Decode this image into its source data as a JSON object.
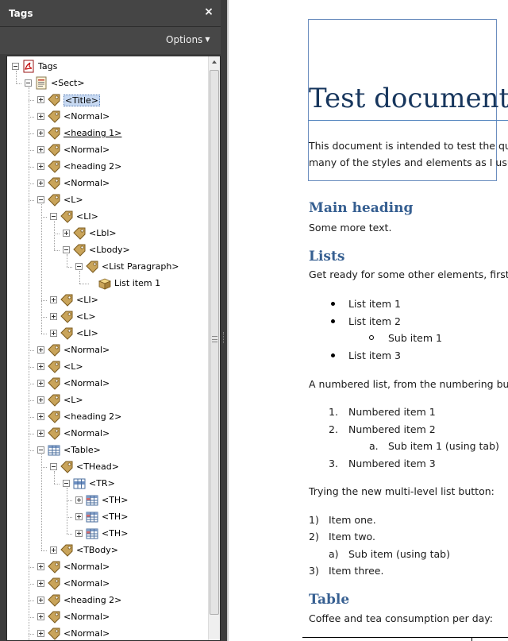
{
  "panel": {
    "title": "Tags",
    "close_glyph": "×",
    "options_label": "Options"
  },
  "tree": [
    {
      "depth": 0,
      "label": "Tags",
      "expanded": true,
      "icon": "pdf-icon"
    },
    {
      "depth": 1,
      "label": "<Sect>",
      "expanded": true,
      "icon": "page-icon"
    },
    {
      "depth": 2,
      "label": "<Title>",
      "expanded": false,
      "icon": "tag-icon",
      "selected": true
    },
    {
      "depth": 2,
      "label": "<Normal>",
      "expanded": false,
      "icon": "tag-icon"
    },
    {
      "depth": 2,
      "label": "<heading 1>",
      "expanded": false,
      "icon": "tag-icon",
      "underline": true
    },
    {
      "depth": 2,
      "label": "<Normal>",
      "expanded": false,
      "icon": "tag-icon"
    },
    {
      "depth": 2,
      "label": "<heading 2>",
      "expanded": false,
      "icon": "tag-icon"
    },
    {
      "depth": 2,
      "label": "<Normal>",
      "expanded": false,
      "icon": "tag-icon"
    },
    {
      "depth": 2,
      "label": "<L>",
      "expanded": true,
      "icon": "tag-icon"
    },
    {
      "depth": 3,
      "label": "<LI>",
      "expanded": true,
      "icon": "tag-icon"
    },
    {
      "depth": 4,
      "label": "<Lbl>",
      "expanded": false,
      "icon": "tag-icon"
    },
    {
      "depth": 4,
      "label": "<Lbody>",
      "expanded": true,
      "icon": "tag-icon"
    },
    {
      "depth": 5,
      "label": "<List Paragraph>",
      "expanded": true,
      "icon": "tag-icon"
    },
    {
      "depth": 6,
      "label": "List item 1",
      "expanded": null,
      "icon": "content-box-icon"
    },
    {
      "depth": 3,
      "label": "<LI>",
      "expanded": false,
      "icon": "tag-icon"
    },
    {
      "depth": 3,
      "label": "<L>",
      "expanded": false,
      "icon": "tag-icon"
    },
    {
      "depth": 3,
      "label": "<LI>",
      "expanded": false,
      "icon": "tag-icon"
    },
    {
      "depth": 2,
      "label": "<Normal>",
      "expanded": false,
      "icon": "tag-icon"
    },
    {
      "depth": 2,
      "label": "<L>",
      "expanded": false,
      "icon": "tag-icon"
    },
    {
      "depth": 2,
      "label": "<Normal>",
      "expanded": false,
      "icon": "tag-icon"
    },
    {
      "depth": 2,
      "label": "<L>",
      "expanded": false,
      "icon": "tag-icon"
    },
    {
      "depth": 2,
      "label": "<heading 2>",
      "expanded": false,
      "icon": "tag-icon"
    },
    {
      "depth": 2,
      "label": "<Normal>",
      "expanded": false,
      "icon": "tag-icon"
    },
    {
      "depth": 2,
      "label": "<Table>",
      "expanded": true,
      "icon": "table-icon"
    },
    {
      "depth": 3,
      "label": "<THead>",
      "expanded": true,
      "icon": "tag-icon"
    },
    {
      "depth": 4,
      "label": "<TR>",
      "expanded": true,
      "icon": "table-row-icon"
    },
    {
      "depth": 5,
      "label": "<TH>",
      "expanded": false,
      "icon": "table-cell-icon"
    },
    {
      "depth": 5,
      "label": "<TH>",
      "expanded": false,
      "icon": "table-cell-icon"
    },
    {
      "depth": 5,
      "label": "<TH>",
      "expanded": false,
      "icon": "table-cell-icon"
    },
    {
      "depth": 3,
      "label": "<TBody>",
      "expanded": false,
      "icon": "tag-icon"
    },
    {
      "depth": 2,
      "label": "<Normal>",
      "expanded": false,
      "icon": "tag-icon"
    },
    {
      "depth": 2,
      "label": "<Normal>",
      "expanded": false,
      "icon": "tag-icon"
    },
    {
      "depth": 2,
      "label": "<heading 2>",
      "expanded": false,
      "icon": "tag-icon"
    },
    {
      "depth": 2,
      "label": "<Normal>",
      "expanded": false,
      "icon": "tag-icon"
    },
    {
      "depth": 2,
      "label": "<Normal>",
      "expanded": false,
      "icon": "tag-icon"
    }
  ],
  "document": {
    "title": "Test document",
    "intro_line1": "This document is intended to test the qu",
    "intro_line2": "many of the styles and elements as I usu",
    "heading_main": "Main heading",
    "main_text": "Some more text.",
    "heading_lists": "Lists",
    "lists_text": "Get ready for some other elements, first",
    "bullets": [
      "List item 1",
      "List item 2",
      "Sub item 1",
      "List item 3"
    ],
    "numbered_intro": "A numbered list, from the numbering bu",
    "numbered": [
      {
        "marker": "1.",
        "text": "Numbered item 1"
      },
      {
        "marker": "2.",
        "text": "Numbered item 2"
      },
      {
        "marker": "a.",
        "text": "Sub item 1 (using tab)"
      },
      {
        "marker": "3.",
        "text": "Numbered item 3"
      }
    ],
    "multilevel_intro": "Trying the new multi-level list button:",
    "multilevel": [
      {
        "marker": "1)",
        "text": "Item one."
      },
      {
        "marker": "2)",
        "text": "Item two."
      },
      {
        "marker": "a)",
        "text": "Sub item (using tab)"
      },
      {
        "marker": "3)",
        "text": "Item three."
      }
    ],
    "heading_table": "Table",
    "table_text": "Coffee and tea consumption per day:"
  },
  "colors": {
    "panel_bg": "#3c3c3c",
    "selection": "#c7d9f2",
    "doc_title": "#17365d",
    "heading": "#365f91"
  }
}
